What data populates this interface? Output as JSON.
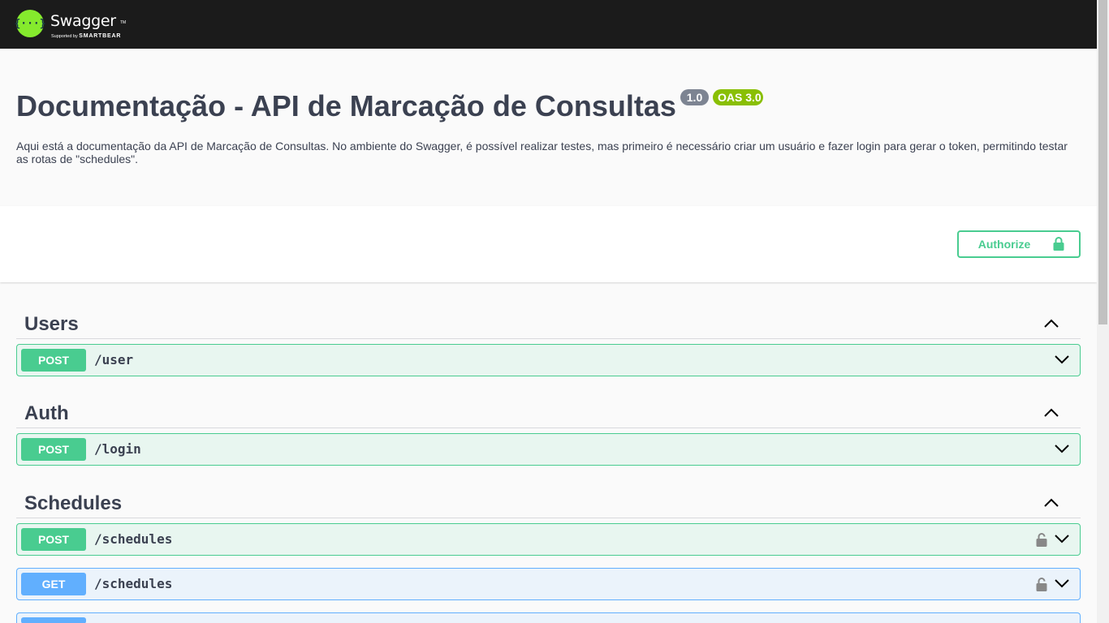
{
  "topbar": {
    "logo_symbol": "{···}",
    "logo_text": "Swagger",
    "logo_tm": "TM",
    "logo_sub_prefix": "Supported by",
    "logo_sub_brand": "SMARTBEAR"
  },
  "info": {
    "title": "Documentação - API de Marcação de Consultas",
    "version": "1.0",
    "oas": "OAS 3.0",
    "description": "Aqui está a documentação da API de Marcação de Consultas. No ambiente do Swagger, é possível realizar testes, mas primeiro é necessário criar um usuário e fazer login para gerar o token, permitindo testar as rotas de \"schedules\"."
  },
  "authorize": {
    "label": "Authorize",
    "icon": "lock-icon"
  },
  "tags": [
    {
      "name": "Users",
      "operations": [
        {
          "method": "POST",
          "path": "/user",
          "locked": false
        }
      ]
    },
    {
      "name": "Auth",
      "operations": [
        {
          "method": "POST",
          "path": "/login",
          "locked": false
        }
      ]
    },
    {
      "name": "Schedules",
      "operations": [
        {
          "method": "POST",
          "path": "/schedules",
          "locked": true
        },
        {
          "method": "GET",
          "path": "/schedules",
          "locked": true
        }
      ]
    }
  ],
  "colors": {
    "topbar": "#1b1b1b",
    "logo": "#85ea2d",
    "post": "#49cc90",
    "get": "#61affe",
    "version_badge": "#7d8492",
    "oas_badge": "#89bf04"
  }
}
